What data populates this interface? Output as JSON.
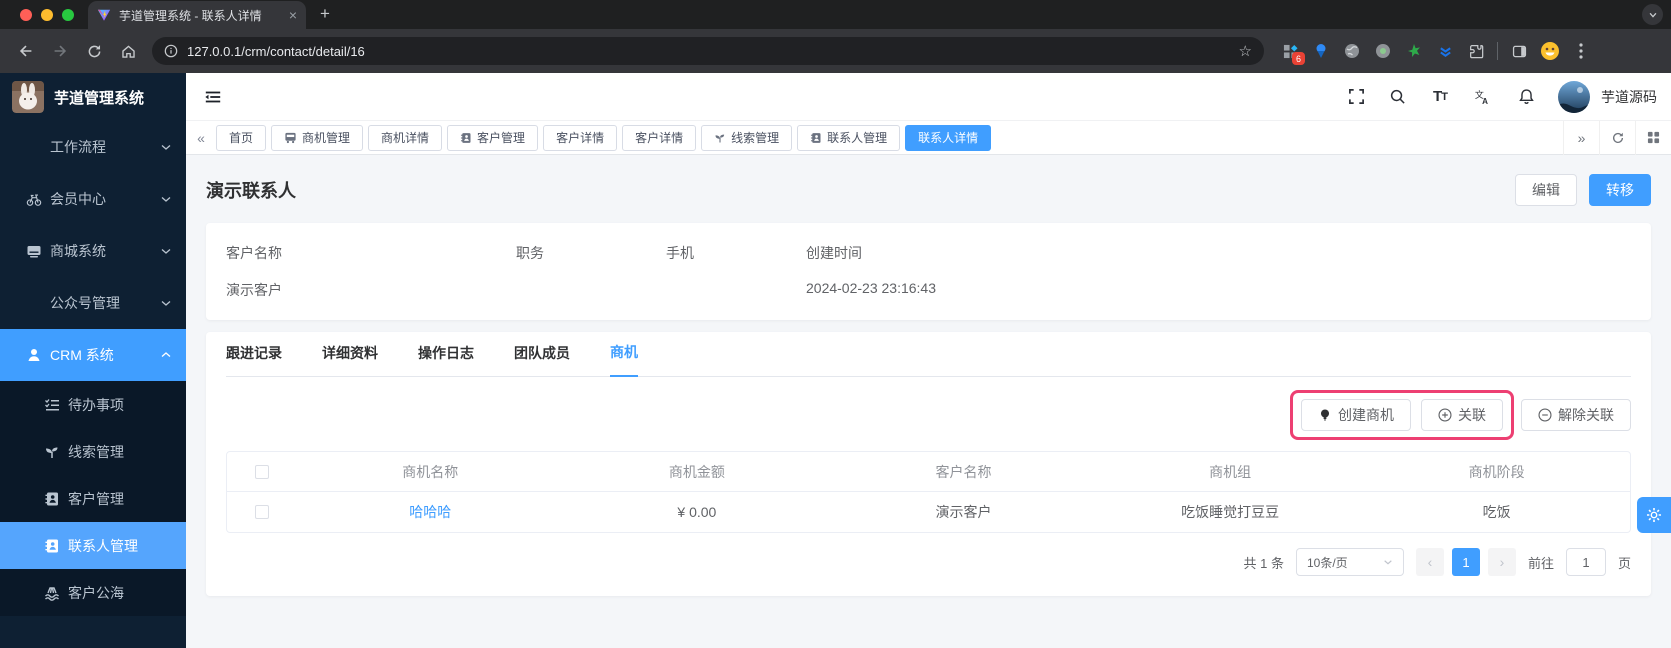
{
  "browser": {
    "tab_title": "芋道管理系统 - 联系人详情",
    "url": "127.0.0.1/crm/contact/detail/16",
    "extension_badge": "6"
  },
  "glyphs": {
    "close": "×",
    "new_tab": "+",
    "star": "☆",
    "collapse_left": "«",
    "collapse_right": "»",
    "prev": "‹",
    "next": "›"
  },
  "sidebar": {
    "app_title": "芋道管理系统",
    "items": [
      {
        "label": "工作流程"
      },
      {
        "label": "会员中心"
      },
      {
        "label": "商城系统"
      },
      {
        "label": "公众号管理"
      },
      {
        "label": "CRM 系统"
      },
      {
        "label": "待办事项"
      },
      {
        "label": "线索管理"
      },
      {
        "label": "客户管理"
      },
      {
        "label": "联系人管理"
      },
      {
        "label": "客户公海"
      }
    ]
  },
  "navbar": {
    "username": "芋道源码"
  },
  "tags": {
    "items": [
      "首页",
      "商机管理",
      "商机详情",
      "客户管理",
      "客户详情",
      "客户详情",
      "线索管理",
      "联系人管理",
      "联系人详情"
    ],
    "active": "联系人详情"
  },
  "page": {
    "title": "演示联系人",
    "buttons": {
      "edit": "编辑",
      "transfer": "转移"
    },
    "info_fields": [
      {
        "label": "客户名称",
        "value": "演示客户"
      },
      {
        "label": "职务",
        "value": ""
      },
      {
        "label": "手机",
        "value": ""
      },
      {
        "label": "创建时间",
        "value": "2024-02-23 23:16:43"
      }
    ],
    "tabs": [
      "跟进记录",
      "详细资料",
      "操作日志",
      "团队成员",
      "商机"
    ],
    "active_tab": "商机",
    "actions": {
      "create": "创建商机",
      "link": "关联",
      "unlink": "解除关联"
    },
    "table": {
      "headers": [
        "商机名称",
        "商机金额",
        "客户名称",
        "商机组",
        "商机阶段"
      ],
      "rows": [
        {
          "name": "哈哈哈",
          "amount": "¥ 0.00",
          "customer": "演示客户",
          "group": "吃饭睡觉打豆豆",
          "stage": "吃饭"
        }
      ]
    },
    "pagination": {
      "total": "共 1 条",
      "page_size": "10条/页",
      "current_page": "1",
      "goto": "前往",
      "goto_value": "1",
      "unit": "页"
    }
  },
  "colors": {
    "accent": "#409eff",
    "active_submenu": "#55a5fd",
    "highlight_box": "#ed3f72",
    "sidebar_bg": "#0e2033",
    "sidebar_submenu_bg": "#0a1828",
    "content_bg": "#f4f6f9",
    "chrome_dark": "#1f2021",
    "chrome_toolbar": "#35363a"
  }
}
